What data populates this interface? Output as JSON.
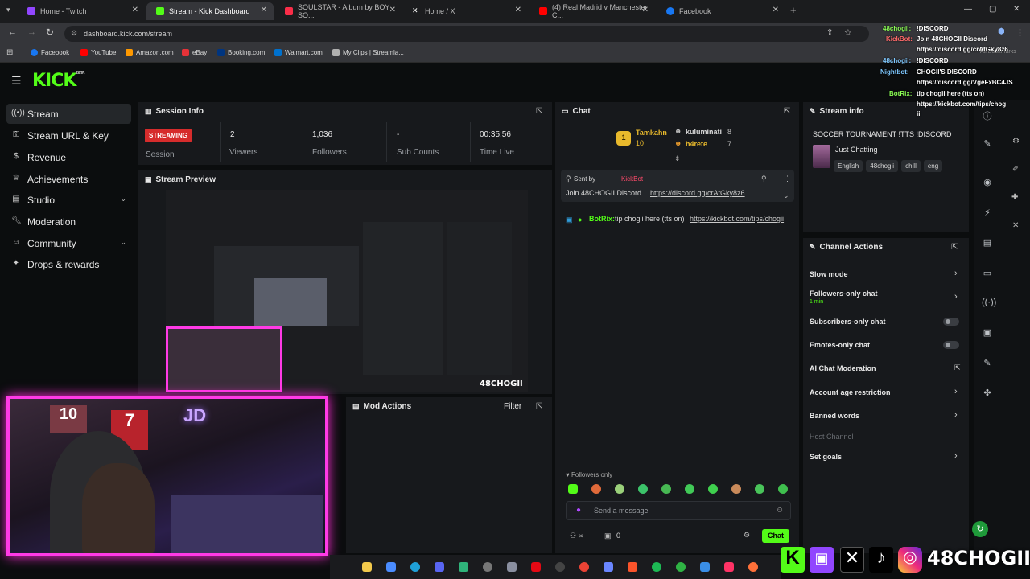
{
  "browser": {
    "tabs": [
      {
        "label": "Home - Twitch",
        "color": "#9146ff"
      },
      {
        "label": "Stream - Kick Dashboard",
        "color": "#53fc18"
      },
      {
        "label": "SOULSTAR - Album by BOY SO...",
        "color": "#fa2d48"
      },
      {
        "label": "Home / X",
        "color": "#ffffff"
      },
      {
        "label": "(4) Real Madrid v Manchester C...",
        "color": "#ff0000"
      },
      {
        "label": "Facebook",
        "color": "#1877f2"
      }
    ],
    "url": "dashboard.kick.com/stream",
    "bookmarks": [
      {
        "label": "Facebook",
        "color": "#1877f2"
      },
      {
        "label": "YouTube",
        "color": "#ff0000"
      },
      {
        "label": "Amazon.com",
        "color": "#ff9900"
      },
      {
        "label": "eBay",
        "color": "#e53238"
      },
      {
        "label": "Booking.com",
        "color": "#003580"
      },
      {
        "label": "Walmart.com",
        "color": "#0071ce"
      },
      {
        "label": "My Clips | Streamla...",
        "color": "#b0b0b0"
      }
    ],
    "all_bookmarks": "All Bookmarks"
  },
  "kick": {
    "logo": "KICK",
    "logo_beta": "BETA",
    "accent": "#53fc18"
  },
  "sidebar": {
    "items": [
      {
        "label": "Stream",
        "icon": "stream-icon"
      },
      {
        "label": "Stream URL & Key",
        "icon": "key-icon"
      },
      {
        "label": "Revenue",
        "icon": "dollar-icon"
      },
      {
        "label": "Achievements",
        "icon": "trophy-icon"
      },
      {
        "label": "Studio",
        "icon": "studio-icon"
      },
      {
        "label": "Moderation",
        "icon": "wrench-icon"
      },
      {
        "label": "Community",
        "icon": "people-icon"
      },
      {
        "label": "Drops & rewards",
        "icon": "gift-icon"
      }
    ]
  },
  "session": {
    "title": "Session Info",
    "status": "STREAMING",
    "status_label": "Session",
    "viewers": "2",
    "viewers_label": "Viewers",
    "followers": "1,036",
    "followers_label": "Followers",
    "subs": "-",
    "subs_label": "Sub Counts",
    "time": "00:35:56",
    "time_label": "Time Live"
  },
  "preview": {
    "title": "Stream Preview"
  },
  "mod": {
    "title": "Mod Actions",
    "filter": "Filter"
  },
  "chat": {
    "title": "Chat",
    "top_users": [
      {
        "rank": "1",
        "name": "Tamkahn",
        "count": "10"
      },
      {
        "name": "kuluminati",
        "count": "8"
      },
      {
        "name": "h4rete",
        "count": "7"
      }
    ],
    "pinned_label": "Sent by",
    "pinned_user": "KickBot",
    "pinned_text": "Join 48CHOGII Discord",
    "pinned_link": "https://discord.gg/crAtGky8z6",
    "msg_user": "BotRix:",
    "msg_text": "tip chogii here (tts on)",
    "msg_link": "https://kickbot.com/tips/chogii",
    "followers_only": "Followers only",
    "placeholder": "Send a message",
    "count": "0",
    "button": "Chat"
  },
  "stream_info": {
    "title": "Stream info",
    "stream_title": "SOCCER TOURNAMENT !TTS !DISCORD",
    "category": "Just Chatting",
    "tags": [
      "English",
      "48chogii",
      "chill",
      "eng"
    ]
  },
  "channel_actions": {
    "title": "Channel Actions",
    "items": [
      {
        "label": "Slow mode"
      },
      {
        "label": "Followers-only chat",
        "sub": "1 min"
      },
      {
        "label": "Subscribers-only chat"
      },
      {
        "label": "Emotes-only chat"
      },
      {
        "label": "AI Chat Moderation"
      },
      {
        "label": "Account age restriction"
      },
      {
        "label": "Banned words"
      },
      {
        "label": "Host Channel"
      },
      {
        "label": "Set goals"
      }
    ]
  },
  "overlay_chat": [
    {
      "user": "48chogii:",
      "text": "!DISCORD"
    },
    {
      "user": "KickBot:",
      "text": "Join 48CHOGII Discord"
    },
    {
      "user": "",
      "text": "https://discord.gg/crAtGky8z6"
    },
    {
      "user": "48chogii:",
      "text": "!DISCORD"
    },
    {
      "user": "Nightbot:",
      "text": "CHOGII'S DISCORD"
    },
    {
      "user": "",
      "text": "https://discord.gg/VgeFxBC4JS"
    },
    {
      "user": "BotRix:",
      "text": "tip chogii here (tts on)"
    },
    {
      "user": "",
      "text": "https://kickbot.com/tips/chog"
    },
    {
      "user": "",
      "text": "ii"
    }
  ],
  "brand_overlay": {
    "handle": "48CHOGII",
    "color": "#ffffff"
  },
  "preview_watermark": "48CHOGII"
}
